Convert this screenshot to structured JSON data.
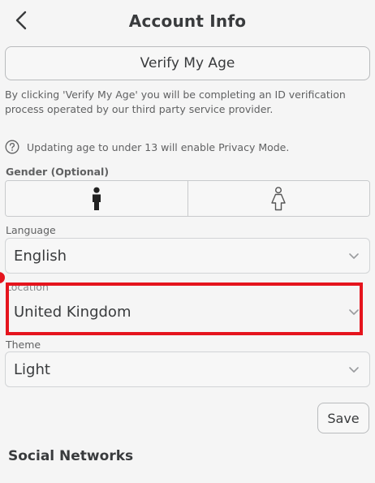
{
  "header": {
    "title": "Account Info"
  },
  "verify": {
    "button_label": "Verify My Age",
    "disclaimer": "By clicking 'Verify My Age' you will be completing an ID verification process operated by our third party service provider.",
    "privacy_note": "Updating age to under 13 will enable Privacy Mode."
  },
  "gender": {
    "label": "Gender (Optional)"
  },
  "language": {
    "label": "Language",
    "value": "English"
  },
  "location": {
    "label": "Location",
    "value": "United Kingdom"
  },
  "theme": {
    "label": "Theme",
    "value": "Light"
  },
  "save_label": "Save",
  "social": {
    "title": "Social Networks"
  },
  "colors": {
    "highlight": "#e5141d",
    "background": "#f5f5f5",
    "text": "#393b3d"
  }
}
